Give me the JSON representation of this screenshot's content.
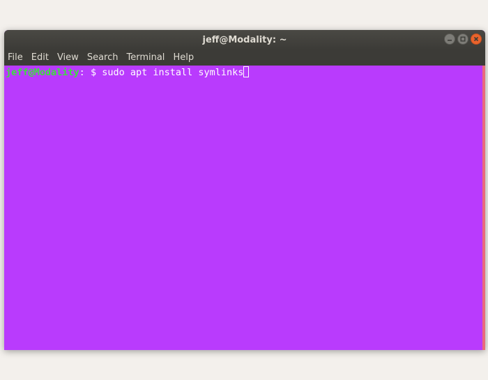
{
  "window": {
    "title": "jeff@Modality: ~"
  },
  "menu": {
    "items": [
      "File",
      "Edit",
      "View",
      "Search",
      "Terminal",
      "Help"
    ]
  },
  "terminal": {
    "user_host": "jeff@Modality",
    "separator": ":",
    "path": " ",
    "prompt_symbol": "$",
    "command": " sudo apt install symlinks"
  },
  "colors": {
    "terminal_bg": "#b93bfd",
    "user_host": "#3ddf3d",
    "titlebar": "#3c3b37",
    "close_button": "#e9632c"
  }
}
